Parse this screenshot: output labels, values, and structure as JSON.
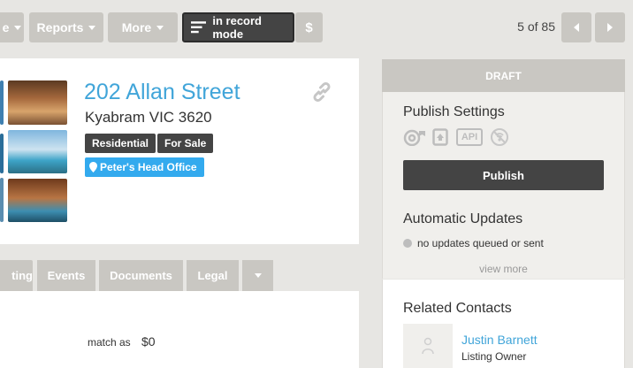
{
  "toolbar": {
    "cut_button_label": "e",
    "reports_label": "Reports",
    "more_label": "More",
    "record_mode_label": "in record mode",
    "dollar_label": "$",
    "pagination": "5 of 85"
  },
  "listing": {
    "address": "202 Allan Street",
    "suburb": "Kyabram VIC 3620",
    "tags": [
      "Residential",
      "For Sale"
    ],
    "office": "Peter's Head Office"
  },
  "tabs": {
    "cut_tab": "ting",
    "events": "Events",
    "documents": "Documents",
    "legal": "Legal"
  },
  "details": {
    "match_label": "match as",
    "match_value": "$0"
  },
  "sidebar": {
    "status": "DRAFT",
    "publish_settings_title": "Publish Settings",
    "api_label": "API",
    "publish_button": "Publish",
    "auto_updates_title": "Automatic Updates",
    "auto_updates_status": "no updates queued or sent",
    "view_more": "view more",
    "related_contacts_title": "Related Contacts",
    "contact_name": "Justin Barnett",
    "contact_role": "Listing Owner"
  },
  "colors": {
    "accent_blue": "#41a5d9",
    "office_tag": "#33aaee",
    "dark_button": "#444444",
    "grey_button": "#c9c7c2"
  }
}
